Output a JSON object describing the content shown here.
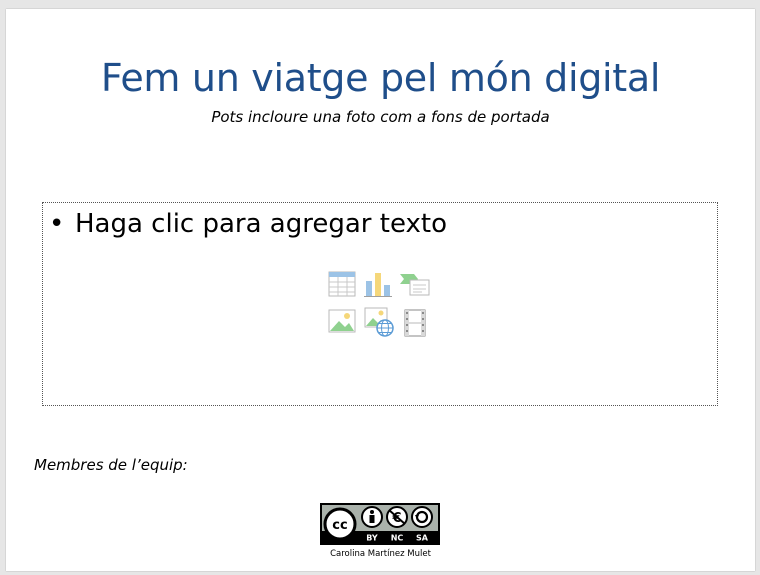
{
  "slide": {
    "title": "Fem un viatge pel món digital",
    "subtitle": "Pots incloure una foto com a fons de portada",
    "content_placeholder": {
      "bullet": "•",
      "text": "Haga clic para agregar texto",
      "insert_icons": [
        "insert-table-icon",
        "insert-chart-icon",
        "insert-smartart-icon",
        "insert-picture-icon",
        "insert-online-picture-icon",
        "insert-video-icon"
      ]
    },
    "members_label": "Membres de l’equip:",
    "license": {
      "icon": "cc-by-nc-sa-license-icon",
      "labels": [
        "BY",
        "NC",
        "SA"
      ]
    },
    "author": "Carolina Martínez Mulet"
  },
  "colors": {
    "title": "#1f4e8a",
    "background": "#ffffff",
    "window": "#e6e6e6"
  }
}
